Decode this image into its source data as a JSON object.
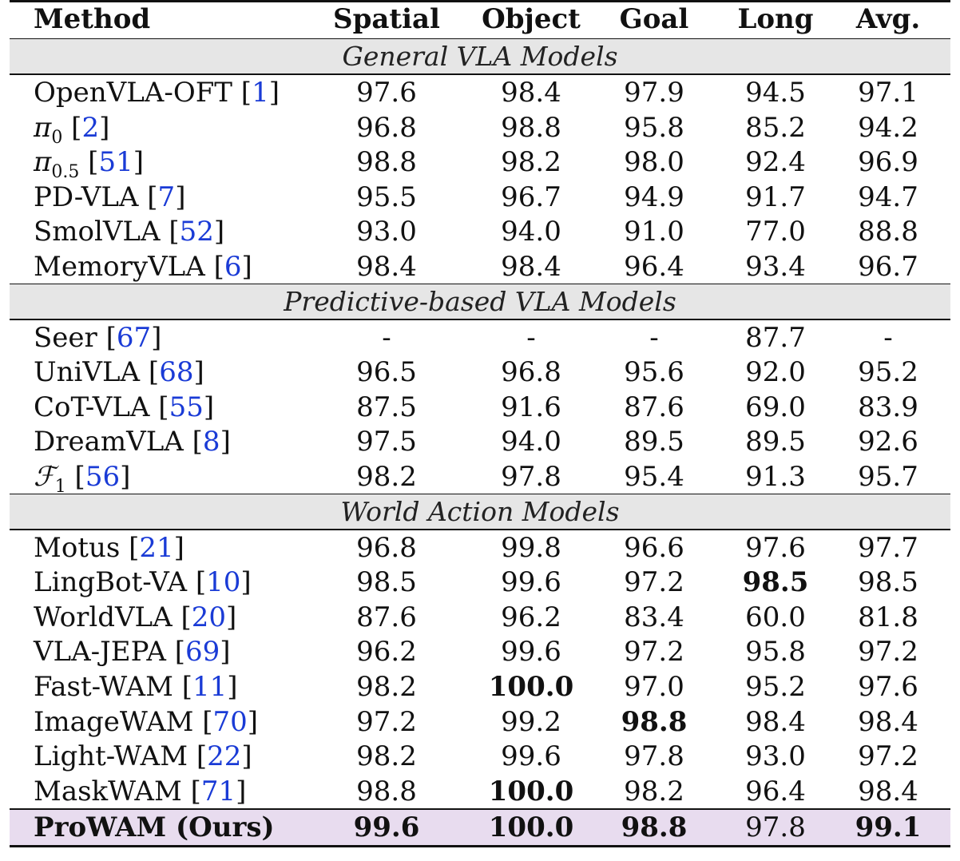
{
  "headers": [
    "Method",
    "Spatial",
    "Object",
    "Goal",
    "Long",
    "Avg."
  ],
  "sections": [
    {
      "title": "General VLA Models",
      "rows": [
        {
          "name": "OpenVLA-OFT",
          "ref": "1",
          "values": [
            "97.6",
            "98.4",
            "97.9",
            "94.5",
            "97.1"
          ],
          "bold": []
        },
        {
          "name": "π",
          "sub": "0",
          "ref": "2",
          "values": [
            "96.8",
            "98.8",
            "95.8",
            "85.2",
            "94.2"
          ],
          "bold": []
        },
        {
          "name": "π",
          "sub": "0.5",
          "ref": "51",
          "values": [
            "98.8",
            "98.2",
            "98.0",
            "92.4",
            "96.9"
          ],
          "bold": []
        },
        {
          "name": "PD-VLA",
          "ref": "7",
          "values": [
            "95.5",
            "96.7",
            "94.9",
            "91.7",
            "94.7"
          ],
          "bold": []
        },
        {
          "name": "SmolVLA",
          "ref": "52",
          "values": [
            "93.0",
            "94.0",
            "91.0",
            "77.0",
            "88.8"
          ],
          "bold": []
        },
        {
          "name": "MemoryVLA",
          "ref": "6",
          "values": [
            "98.4",
            "98.4",
            "96.4",
            "93.4",
            "96.7"
          ],
          "bold": []
        }
      ]
    },
    {
      "title": "Predictive-based VLA Models",
      "rows": [
        {
          "name": "Seer",
          "ref": "67",
          "values": [
            "-",
            "-",
            "-",
            "87.7",
            "-"
          ],
          "bold": []
        },
        {
          "name": "UniVLA",
          "ref": "68",
          "values": [
            "96.5",
            "96.8",
            "95.6",
            "92.0",
            "95.2"
          ],
          "bold": []
        },
        {
          "name": "CoT-VLA",
          "ref": "55",
          "values": [
            "87.5",
            "91.6",
            "87.6",
            "69.0",
            "83.9"
          ],
          "bold": []
        },
        {
          "name": "DreamVLA",
          "ref": "8",
          "values": [
            "97.5",
            "94.0",
            "89.5",
            "89.5",
            "92.6"
          ],
          "bold": []
        },
        {
          "name": "ℱ",
          "sub": "1",
          "ref": "56",
          "values": [
            "98.2",
            "97.8",
            "95.4",
            "91.3",
            "95.7"
          ],
          "bold": []
        }
      ]
    },
    {
      "title": "World Action Models",
      "rows": [
        {
          "name": "Motus",
          "ref": "21",
          "values": [
            "96.8",
            "99.8",
            "96.6",
            "97.6",
            "97.7"
          ],
          "bold": []
        },
        {
          "name": "LingBot-VA",
          "ref": "10",
          "values": [
            "98.5",
            "99.6",
            "97.2",
            "98.5",
            "98.5"
          ],
          "bold": [
            3
          ]
        },
        {
          "name": "WorldVLA",
          "ref": "20",
          "values": [
            "87.6",
            "96.2",
            "83.4",
            "60.0",
            "81.8"
          ],
          "bold": []
        },
        {
          "name": "VLA-JEPA",
          "ref": "69",
          "values": [
            "96.2",
            "99.6",
            "97.2",
            "95.8",
            "97.2"
          ],
          "bold": []
        },
        {
          "name": "Fast-WAM",
          "ref": "11",
          "values": [
            "98.2",
            "100.0",
            "97.0",
            "95.2",
            "97.6"
          ],
          "bold": [
            1
          ]
        },
        {
          "name": "ImageWAM",
          "ref": "70",
          "values": [
            "97.2",
            "99.2",
            "98.8",
            "98.4",
            "98.4"
          ],
          "bold": [
            2
          ]
        },
        {
          "name": "Light-WAM",
          "ref": "22",
          "values": [
            "98.2",
            "99.6",
            "97.8",
            "93.0",
            "97.2"
          ],
          "bold": []
        },
        {
          "name": "MaskWAM",
          "ref": "71",
          "values": [
            "98.8",
            "100.0",
            "98.2",
            "96.4",
            "98.4"
          ],
          "bold": [
            1
          ]
        }
      ]
    }
  ],
  "ours": {
    "name": "ProWAM (Ours)",
    "values": [
      "99.6",
      "100.0",
      "98.8",
      "97.8",
      "99.1"
    ],
    "bold": [
      0,
      1,
      2,
      4
    ]
  },
  "colors": {
    "citation": "#1a3bd6",
    "section_bg": "#e6e6e6",
    "ours_bg": "#e8dcef"
  }
}
